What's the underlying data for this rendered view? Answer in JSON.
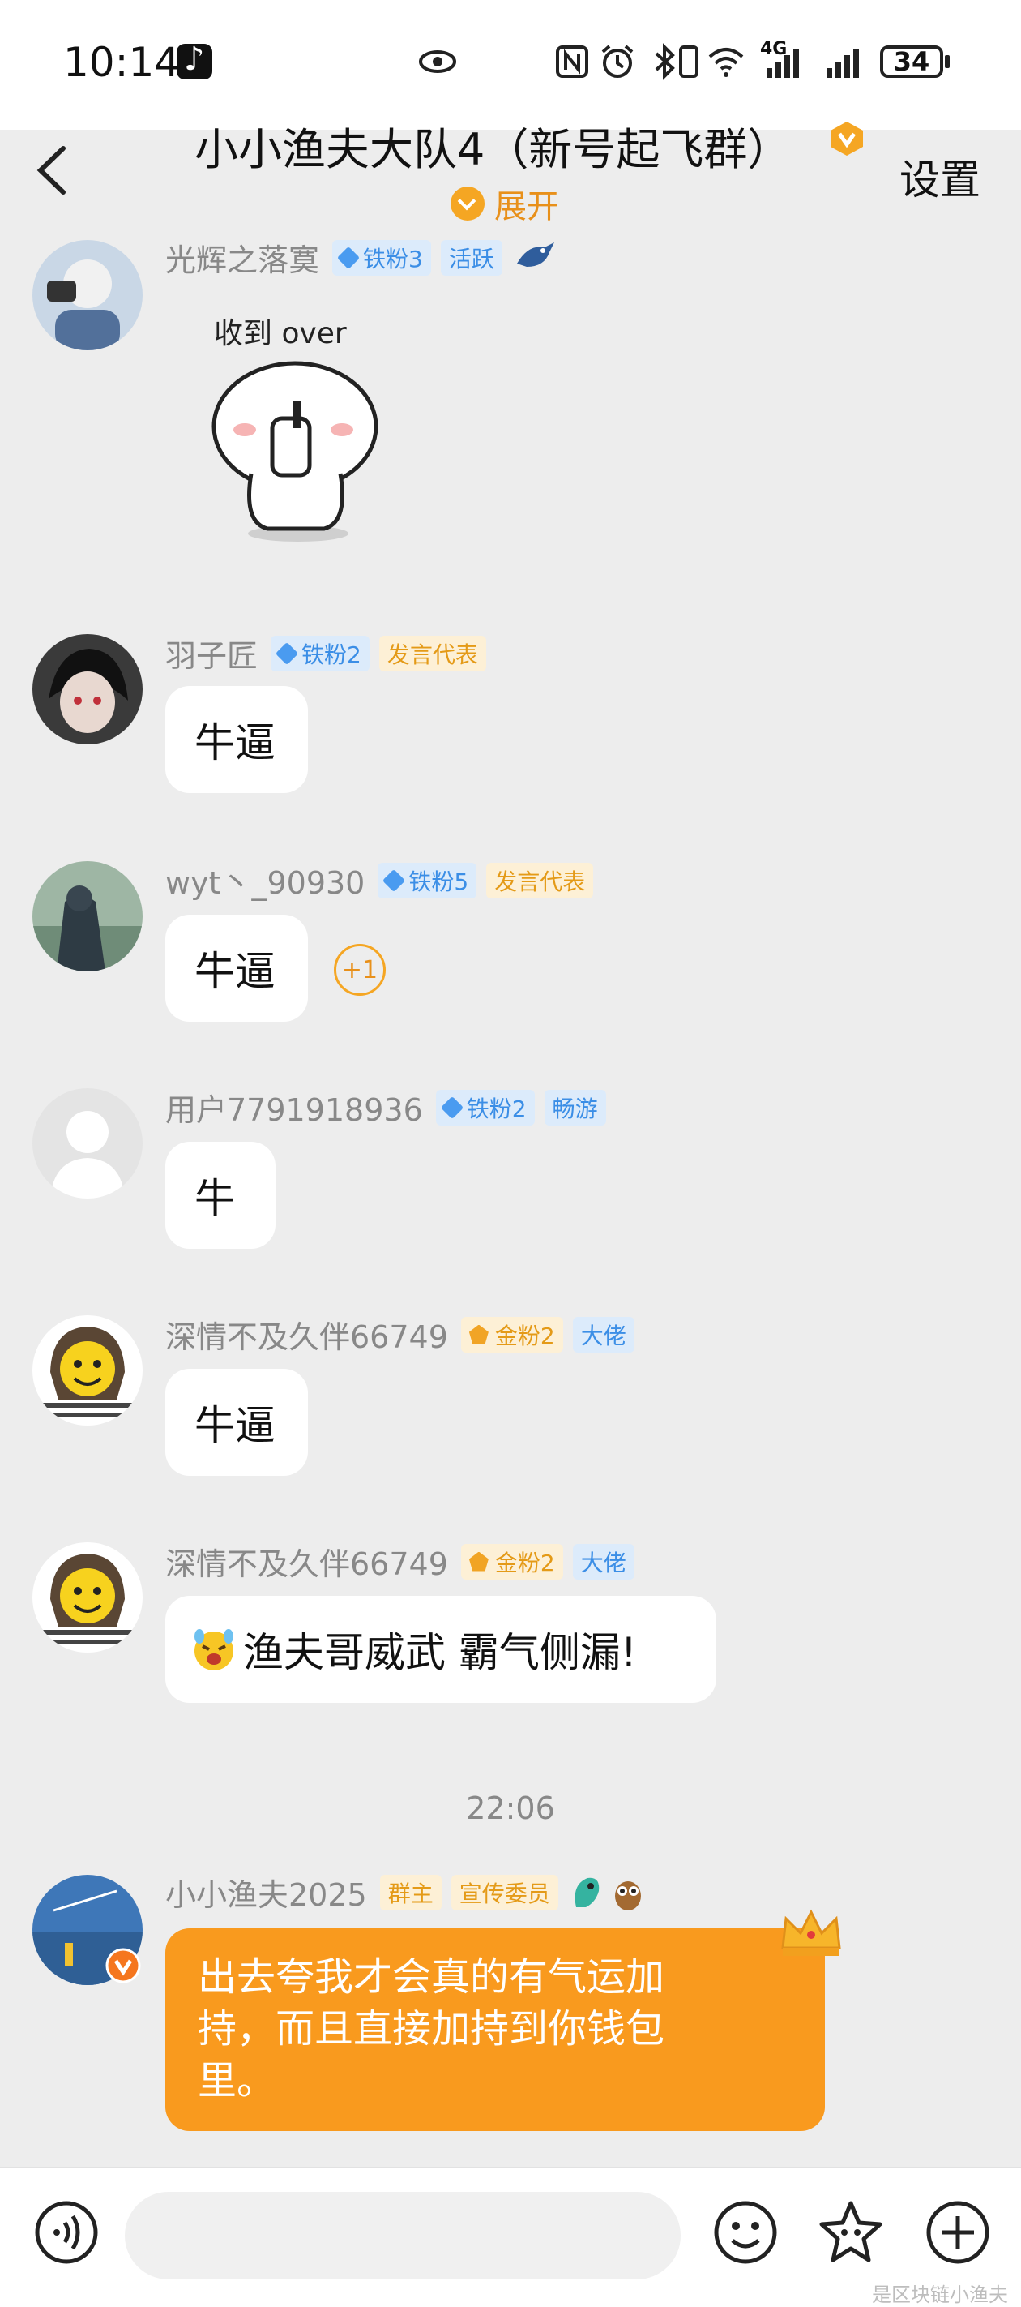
{
  "status_bar": {
    "time": "10:14",
    "network": "4G",
    "battery": "34"
  },
  "header": {
    "title": "小小渔夫大队4（新号起飞群）",
    "expand_label": "展开",
    "settings_label": "设置"
  },
  "messages": [
    {
      "user": "光辉之落寞",
      "tags": [
        "铁粉3",
        "活跃"
      ],
      "sticker_text": "收到 over"
    },
    {
      "user": "羽子匠",
      "tags": [
        "铁粉2",
        "发言代表"
      ],
      "text": "牛逼"
    },
    {
      "user": "wyt丶_90930",
      "tags": [
        "铁粉5",
        "发言代表"
      ],
      "text": "牛逼",
      "reaction": "+1"
    },
    {
      "user": "用户7791918936",
      "tags": [
        "铁粉2",
        "畅游"
      ],
      "text": "牛"
    },
    {
      "user": "深情不及久伴66749",
      "tags": [
        "金粉2",
        "大佬"
      ],
      "text": "牛逼"
    },
    {
      "user": "深情不及久伴66749",
      "tags": [
        "金粉2",
        "大佬"
      ],
      "text": "渔夫哥威武 霸气侧漏!"
    },
    {
      "user": "小小渔夫2025",
      "tags": [
        "群主",
        "宣传委员"
      ],
      "text": "出去夸我才会真的有气运加持，而且直接加持到你钱包里。",
      "lines": [
        "出去夸我才会真的有气运加",
        "持，而且直接加持到你钱包",
        "里。"
      ]
    }
  ],
  "timestamp": "22:06",
  "watermark": "是区块链小渔夫",
  "colors": {
    "accent": "#f99a1e",
    "fan_badge": "#3b8ee6",
    "gold_badge": "#e49a17",
    "background": "#ededed"
  }
}
